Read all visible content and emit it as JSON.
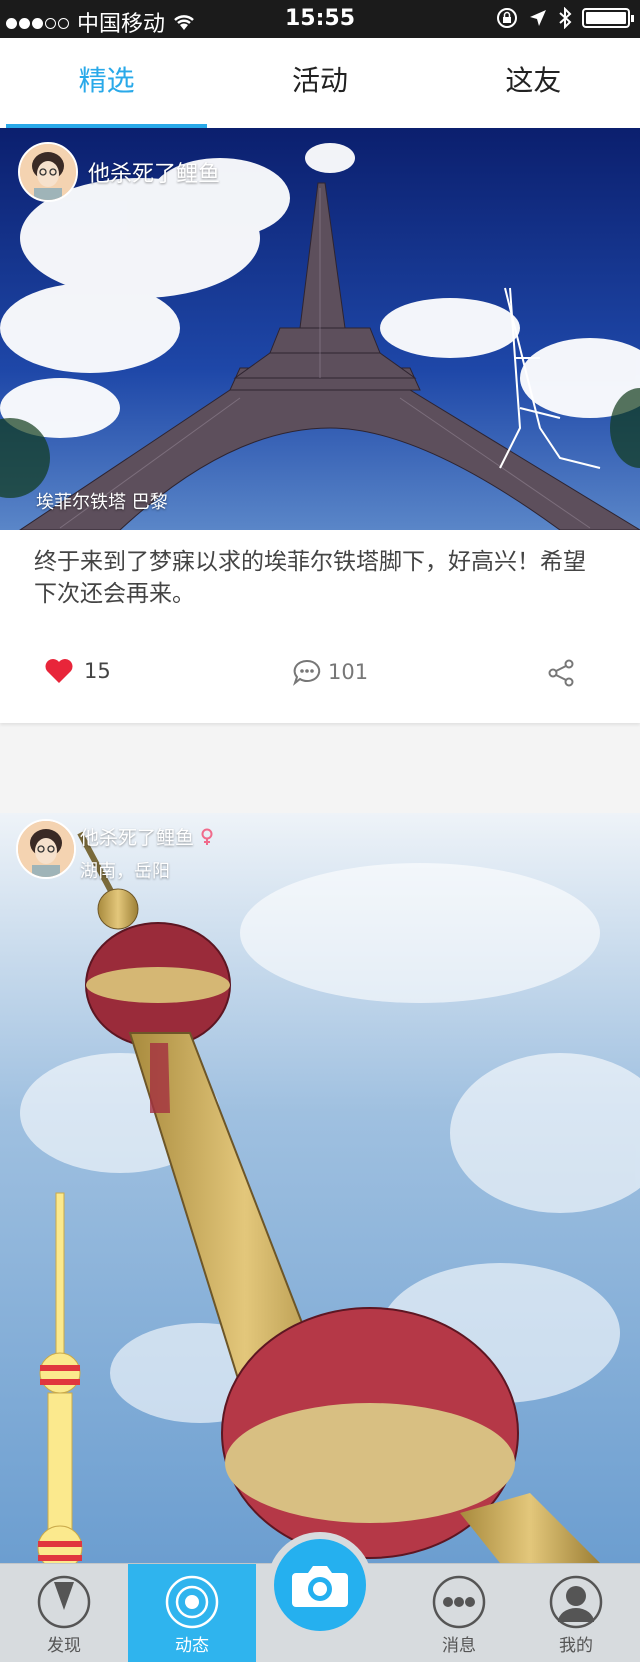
{
  "status_bar": {
    "carrier": "中国移动",
    "time": "15:55"
  },
  "top_tabs": [
    {
      "label": "精选",
      "active": true
    },
    {
      "label": "活动",
      "active": false
    },
    {
      "label": "这友",
      "active": false
    }
  ],
  "post1": {
    "username": "他杀死了鲤鱼",
    "photo_location": "埃菲尔铁塔 巴黎",
    "caption": "终于来到了梦寐以求的埃菲尔铁塔脚下，好高兴！希望下次还会再来。",
    "likes": "15",
    "comments": "101"
  },
  "post2": {
    "username": "他杀死了鲤鱼",
    "location": "湖南，岳阳"
  },
  "bottom_nav": [
    {
      "label": "发现",
      "active": false
    },
    {
      "label": "动态",
      "active": true
    },
    {
      "label": "消息",
      "active": false
    },
    {
      "label": "我的",
      "active": false
    }
  ],
  "colors": {
    "accent": "#29a9e9",
    "like": "#e8253a",
    "tabbar_active": "#2fb4ee"
  }
}
